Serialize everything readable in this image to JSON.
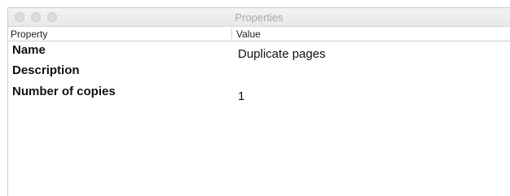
{
  "window": {
    "title": "Properties"
  },
  "table": {
    "headers": {
      "property": "Property",
      "value": "Value"
    },
    "rows": [
      {
        "property": "Name",
        "value": "Duplicate pages"
      },
      {
        "property": "Description",
        "value": ""
      },
      {
        "property": "Number of copies",
        "value": "1"
      }
    ]
  }
}
